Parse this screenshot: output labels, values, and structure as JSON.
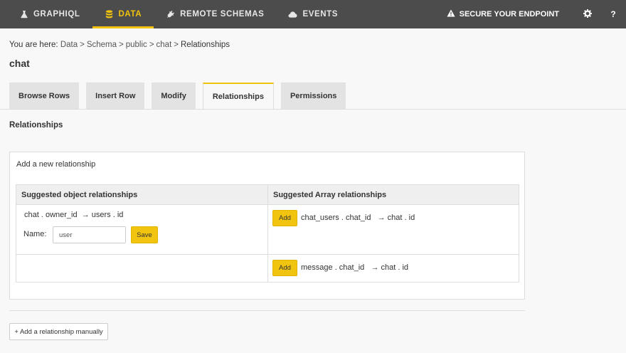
{
  "nav": {
    "items": [
      {
        "label": "GRAPHIQL",
        "icon": "flask-icon"
      },
      {
        "label": "DATA",
        "icon": "database-icon"
      },
      {
        "label": "REMOTE SCHEMAS",
        "icon": "plug-icon"
      },
      {
        "label": "EVENTS",
        "icon": "cloud-icon"
      }
    ],
    "secure_label": "SECURE YOUR ENDPOINT",
    "help_label": "?",
    "accent_color": "#f1c30b"
  },
  "breadcrumb": {
    "prefix": "You are here: ",
    "items": [
      "Data",
      "Schema",
      "public",
      "chat",
      "Relationships"
    ],
    "separator": ">"
  },
  "page_title": "chat",
  "tabs": [
    "Browse Rows",
    "Insert Row",
    "Modify",
    "Relationships",
    "Permissions"
  ],
  "section_title": "Relationships",
  "add_box": {
    "title": "Add a new relationship",
    "object_header": "Suggested object relationships",
    "array_header": "Suggested Array relationships",
    "object_rel": {
      "text": "chat . owner_id  → users . id",
      "name_label": "Name:",
      "name_value": "user",
      "save_label": "Save"
    },
    "array_rels": [
      {
        "add_label": "Add",
        "text": "chat_users . chat_id   → chat . id"
      },
      {
        "add_label": "Add",
        "text": "message . chat_id   → chat . id"
      }
    ]
  },
  "manual_button": "+ Add a relationship manually"
}
